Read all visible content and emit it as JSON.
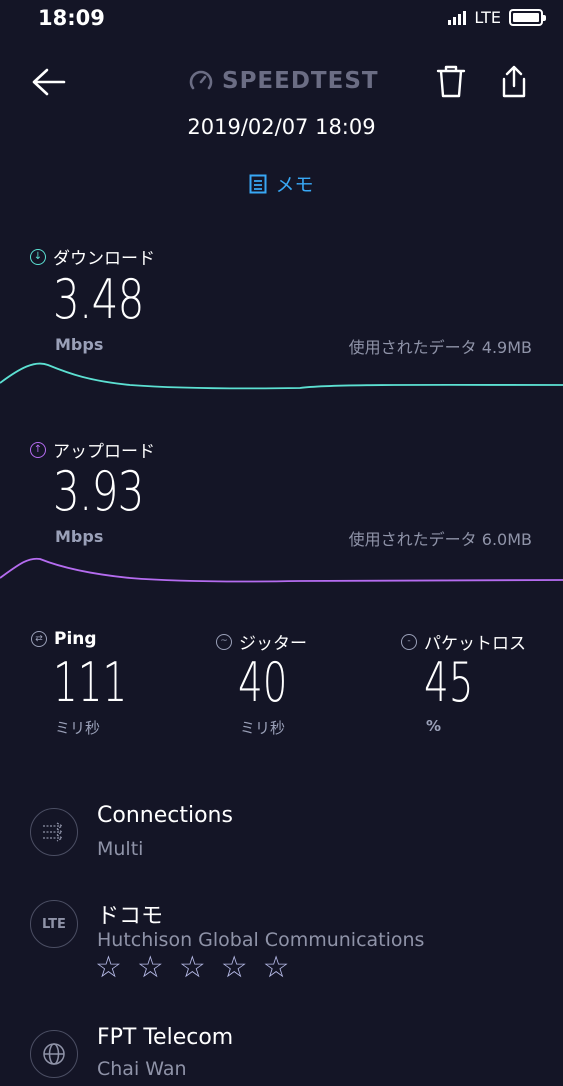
{
  "status": {
    "time": "18:09",
    "network": "LTE"
  },
  "header": {
    "logo": "SPEEDTEST"
  },
  "result": {
    "datetime": "2019/02/07 18:09",
    "memo_label": "メモ"
  },
  "download": {
    "label": "ダウンロード",
    "value": "3.48",
    "unit": "Mbps",
    "data_used": "使用されたデータ 4.9MB",
    "color": "#5ce0d2"
  },
  "upload": {
    "label": "アップロード",
    "value": "3.93",
    "unit": "Mbps",
    "data_used": "使用されたデータ 6.0MB",
    "color": "#b56cf0"
  },
  "stats": {
    "ping": {
      "label": "Ping",
      "value": "111",
      "unit": "ミリ秒"
    },
    "jitter": {
      "label": "ジッター",
      "value": "40",
      "unit": "ミリ秒"
    },
    "packet_loss": {
      "label": "パケットロス",
      "value": "45",
      "unit": "%"
    }
  },
  "connections": {
    "title": "Connections",
    "value": "Multi"
  },
  "carrier": {
    "icon_text": "LTE",
    "title": "ドコモ",
    "provider": "Hutchison Global Communications",
    "rating_stars": 5
  },
  "server": {
    "title": "FPT Telecom",
    "location": "Chai Wan"
  }
}
